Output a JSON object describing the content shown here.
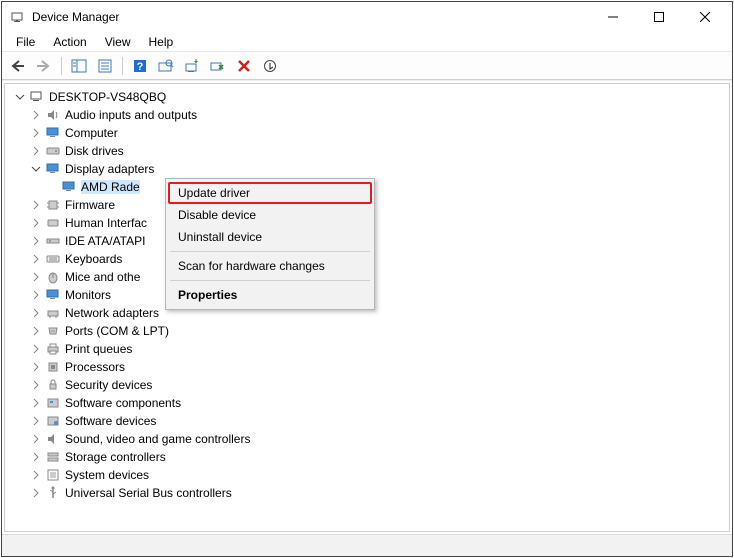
{
  "window": {
    "title": "Device Manager"
  },
  "menubar": {
    "file": "File",
    "action": "Action",
    "view": "View",
    "help": "Help"
  },
  "tree": {
    "root": "DESKTOP-VS48QBQ",
    "audio": "Audio inputs and outputs",
    "computer": "Computer",
    "disk": "Disk drives",
    "display": "Display adapters",
    "display_child": "AMD Rade",
    "firmware": "Firmware",
    "hid": "Human Interfac",
    "ide": "IDE ATA/ATAPI",
    "keyboards": "Keyboards",
    "mice": "Mice and othe",
    "monitors": "Monitors",
    "network": "Network adapters",
    "ports": "Ports (COM & LPT)",
    "print": "Print queues",
    "processors": "Processors",
    "security": "Security devices",
    "softcomp": "Software components",
    "softdev": "Software devices",
    "sound": "Sound, video and game controllers",
    "storage": "Storage controllers",
    "system": "System devices",
    "usb": "Universal Serial Bus controllers"
  },
  "context": {
    "update": "Update driver",
    "disable": "Disable device",
    "uninstall": "Uninstall device",
    "scan": "Scan for hardware changes",
    "properties": "Properties"
  }
}
